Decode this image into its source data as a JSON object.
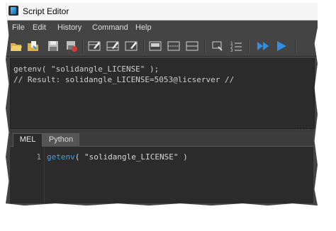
{
  "window": {
    "title": "Script Editor"
  },
  "menu": {
    "items": [
      "File",
      "Edit",
      "History",
      "Command",
      "Help"
    ]
  },
  "toolbar": {
    "icons": [
      "open-script-icon",
      "source-script-icon",
      "save-script-icon",
      "save-selected-to-shelf-icon",
      "clear-history-icon",
      "clear-input-icon",
      "clear-all-icon",
      "show-history-only-icon",
      "show-both-icon",
      "show-input-only-icon",
      "echo-all-commands-icon",
      "show-line-numbers-icon",
      "execute-all-icon",
      "execute-icon"
    ]
  },
  "output": {
    "lines": [
      "getenv( \"solidangle_LICENSE\" );",
      "// Result: solidangle_LICENSE=5053@licserver //"
    ]
  },
  "tabs": [
    {
      "label": "MEL",
      "active": true
    },
    {
      "label": "Python",
      "active": false
    }
  ],
  "editor": {
    "line_number": "1",
    "code_keyword": "getenv",
    "code_rest": "( \"solidangle_LICENSE\" )"
  },
  "colors": {
    "background": "#444444",
    "panel": "#2b2b2b",
    "keyword": "#38a5e6",
    "execute": "#2f8fe6"
  }
}
